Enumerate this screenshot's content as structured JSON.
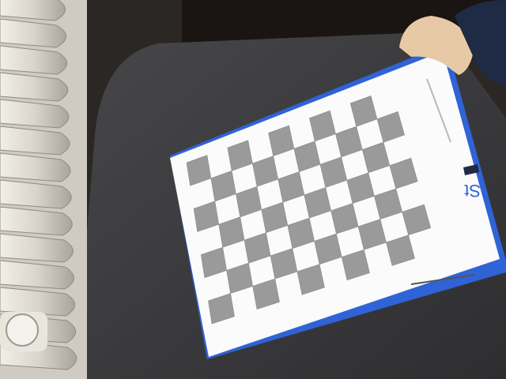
{
  "scene": {
    "board_text": "St",
    "checkerboard": {
      "rows": 7,
      "cols": 10
    },
    "colors": {
      "wall": "#2a2724",
      "table": "#3b3b3d",
      "radiator": "#d8d4cc",
      "board_edge": "#2f63d6",
      "paper": "#fbfbfb",
      "square": "#9a9a9a",
      "skin": "#e8c9a6",
      "sleeve": "#1f2a44"
    }
  }
}
